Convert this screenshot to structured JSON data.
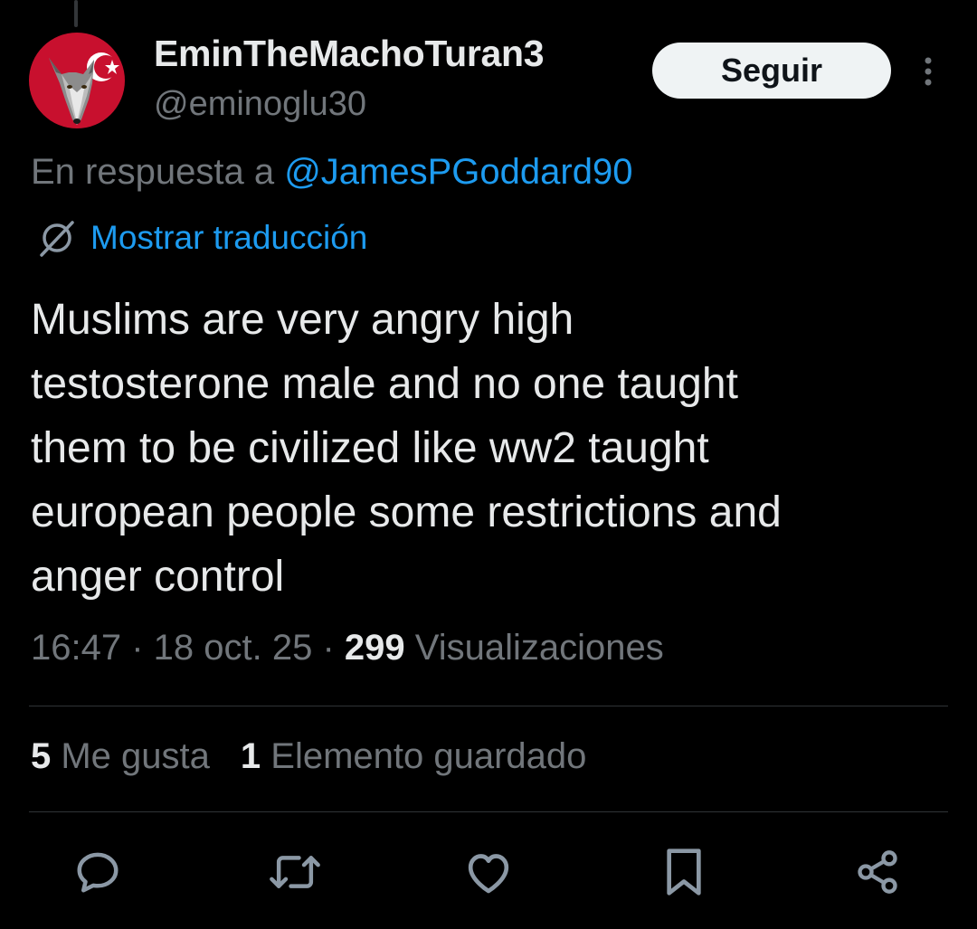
{
  "author": {
    "display_name": "EminTheMachoTuran3",
    "handle": "@eminoglu30"
  },
  "follow_button": {
    "label": "Seguir"
  },
  "reply_context": {
    "prefix": "En respuesta a ",
    "mention": "@JamesPGoddard90"
  },
  "translate": {
    "label": "Mostrar traducción"
  },
  "tweet": {
    "lines": [
      "Muslims are very angry high",
      "testosterone male and no one taught",
      "them to be civilized like ww2 taught",
      "european people some restrictions and",
      "anger control"
    ]
  },
  "meta": {
    "time": "16:47",
    "separator": " · ",
    "date": "18 oct. 25",
    "views_count": "299",
    "views_label": " Visualizaciones"
  },
  "stats": {
    "likes_count": "5",
    "likes_label": " Me gusta",
    "bookmarks_count": "1",
    "bookmarks_label": " Elemento guardado"
  },
  "actions": [
    "reply-icon",
    "retweet-icon",
    "like-icon",
    "bookmark-icon",
    "share-icon"
  ],
  "colors": {
    "background": "#000000",
    "text": "#e7e9ea",
    "secondary": "#71767b",
    "accent": "#1d9bf0",
    "follow_bg": "#eff3f4",
    "divider": "#2f3336"
  }
}
